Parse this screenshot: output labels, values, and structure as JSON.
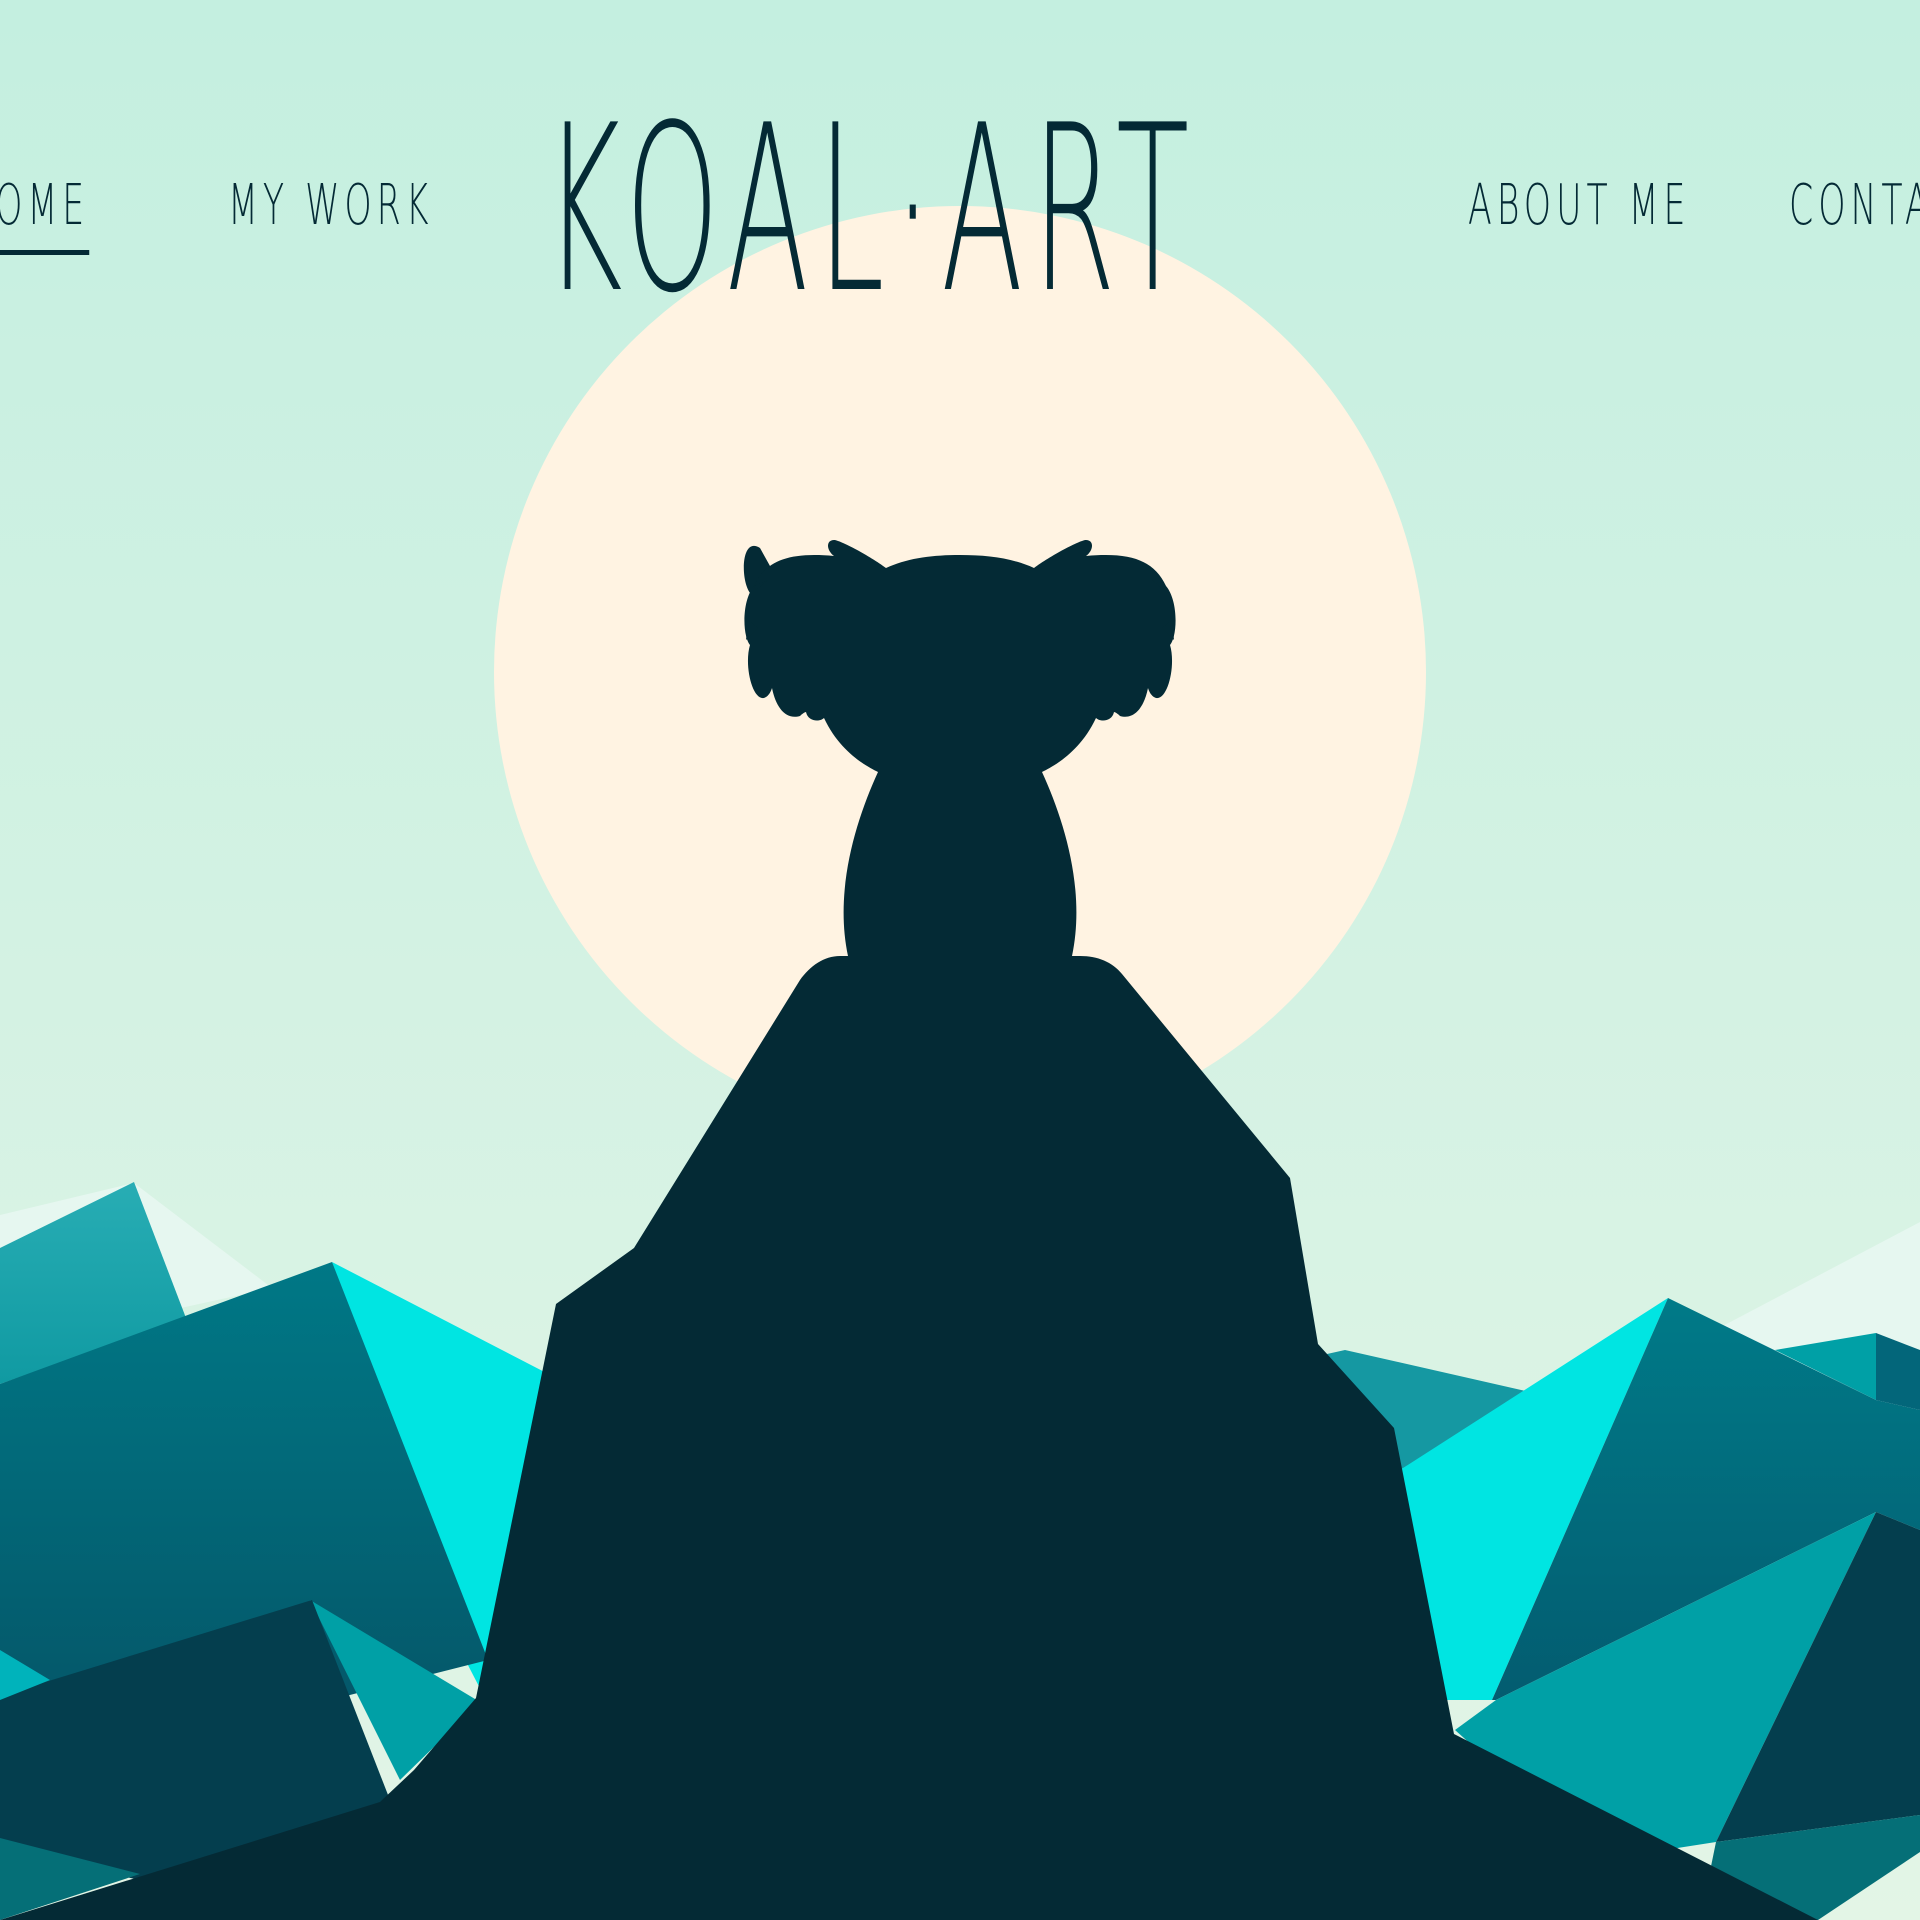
{
  "nav": {
    "home_label": "HOME",
    "work_label": "MY WORK",
    "about_label": "ABOUT ME",
    "contact_label": "CONTACT",
    "active": "home"
  },
  "brand": {
    "logo_text": "KOAL·ART"
  },
  "hero": {
    "scene_icon": "koala-silhouette-on-mountain-peak",
    "colors": {
      "sky_top": "#c4efe0",
      "sky_bottom": "#e2f4e6",
      "sun": "#fff3e2",
      "silhouette": "#042a35",
      "cyan": "#00e5e2",
      "teal": "#007a88",
      "deep_teal": "#035666",
      "navy": "#043e4e"
    }
  }
}
